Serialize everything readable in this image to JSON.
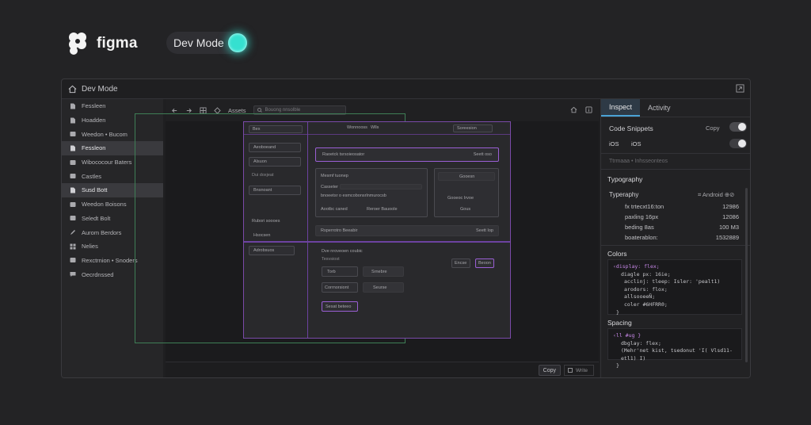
{
  "brand": {
    "name": "figma"
  },
  "devmode": {
    "label": "Dev Mode",
    "toggle_color": "#35e0d0"
  },
  "window": {
    "title": "Dev Mode"
  },
  "layers": [
    {
      "label": "Fessleen",
      "icon": "file-icon"
    },
    {
      "label": "Hoadden",
      "icon": "file-icon"
    },
    {
      "label": "Weedon • Bucom",
      "icon": "frame-icon"
    },
    {
      "label": "Fessleon",
      "icon": "file-icon",
      "selected": true
    },
    {
      "label": "Wibococour Baters",
      "icon": "frame-icon"
    },
    {
      "label": "Castles",
      "icon": "frame-icon"
    },
    {
      "label": "Susd Bott",
      "icon": "file-icon",
      "selected": true
    },
    {
      "label": "Weedon Boisons",
      "icon": "frame-icon"
    },
    {
      "label": "Seledt Bolt",
      "icon": "frame-icon"
    },
    {
      "label": "Aurom Berdors",
      "icon": "pen-icon"
    },
    {
      "label": "Nelies",
      "icon": "grid-icon"
    },
    {
      "label": "Rexctrnion • Snoders",
      "icon": "frame-icon"
    },
    {
      "label": "Oecrdnssed",
      "icon": "chat-icon"
    }
  ],
  "canvas": {
    "toolbar_label": "Assets",
    "search_placeholder": "Bouong nnsolble",
    "copy_label": "Copy",
    "write_label": "Write"
  },
  "mock": {
    "search": "Bex",
    "sidebar_items": [
      "Aeoboeand",
      "Alsuon",
      "Dui doxjeat",
      "Bnsnoant",
      "Rubori soooes",
      "Hsocsen",
      "Adrobsuos"
    ],
    "topbar_items": [
      "Wonnooss",
      "Wlls"
    ],
    "topbar_button": "Soreesion",
    "banner_title": "Raoetck tsrsoieosator",
    "banner_action": "Seett oso",
    "form_title": "Mesmf tuonep",
    "form_label": "Casseter",
    "form_hint": "bnoeetsr o esmcobonsrlnmurocsb",
    "form_footer": [
      "Aootbc caned",
      "Reroer Bauoole"
    ],
    "card_title": "Gooesn",
    "card_text": "Gooeoc Irvoe",
    "card_foot": "Gous",
    "bar_title": "Rsperrotro Beeabir",
    "bar_action": "Seett Iop",
    "list_title": "Dve nroveoen coubic",
    "list_sub": "Tesvsiost",
    "grid": [
      "Torb",
      "Srnebre",
      "Corrnorsiont",
      "Seurse"
    ],
    "buttons": [
      "Encse",
      "Beoon"
    ],
    "footer_btn": "Sesat beteeo"
  },
  "inspect": {
    "tabs": [
      "Inspect",
      "Activity"
    ],
    "code_snippets_label": "Code Snippets",
    "copy_label": "Copy",
    "platforms": [
      "iOS",
      "iOS"
    ],
    "faded_text": "Ttrmaaa • Inhsseonteos",
    "typography_heading": "Typography",
    "typography_label": "Typeraphy",
    "typography_platform": "⌗ Android ⊕⊘",
    "typography_rows": [
      {
        "prop": "fx trtecxt16:ton",
        "val": "12986"
      },
      {
        "prop": "paxling 16px",
        "val": "12086"
      },
      {
        "prop": "beding 8as",
        "val": "100 M3"
      },
      {
        "prop": "boaterablon:",
        "val": "1532889"
      }
    ],
    "colors_heading": "Colors",
    "colors_code": [
      "‹display: flex;",
      "diagle px: 16ie;",
      "acclinj: tleep: Isler: 'pealt1)",
      "arodors: flox;",
      "allsooeeÑ;",
      "coler #6HFRR0;",
      "}"
    ],
    "spacing_heading": "Spacing",
    "spacing_code": [
      "‹ll #ug }",
      "dbglay: flex;",
      "(Mehr'net kist, tsedonut 'I( Vlsd11-etl1) I)",
      "}"
    ]
  }
}
